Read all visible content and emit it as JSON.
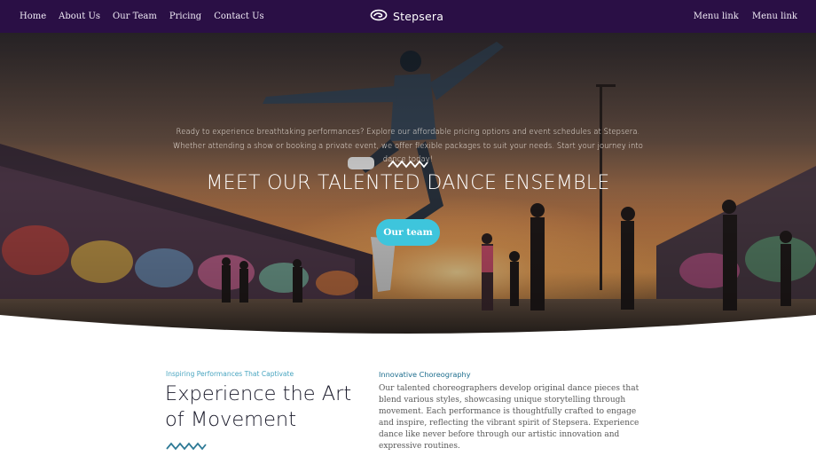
{
  "nav": {
    "left_links": [
      "Home",
      "About Us",
      "Our Team",
      "Pricing",
      "Contact Us"
    ],
    "brand": "Stepsera",
    "brand_icon": "logo-icon",
    "right_links": [
      "Menu link",
      "Menu link"
    ]
  },
  "hero": {
    "description": "Ready to experience breathtaking performances? Explore our affordable pricing options and event schedules at Stepsera. Whether attending a show or booking a private event, we offer flexible packages to suit your needs. Start your journey into dance today!",
    "title": "MEET OUR TALENTED DANCE ENSEMBLE",
    "button": "Our team"
  },
  "section": {
    "eyebrow_left": "Inspiring Performances That Captivate",
    "heading": "Experience the Art of Movement",
    "eyebrow_right": "Innovative Choreography",
    "paragraph": "Our talented choreographers develop original dance pieces that blend various styles, showcasing unique storytelling through movement. Each performance is thoughtfully crafted to engage and inspire, reflecting the vibrant spirit of Stepsera. Experience dance like never before through our artistic innovation and expressive routines."
  },
  "colors": {
    "nav_bg": "#2a0f45",
    "accent": "#3ec5dc",
    "zigzag": "#2e7a96"
  }
}
